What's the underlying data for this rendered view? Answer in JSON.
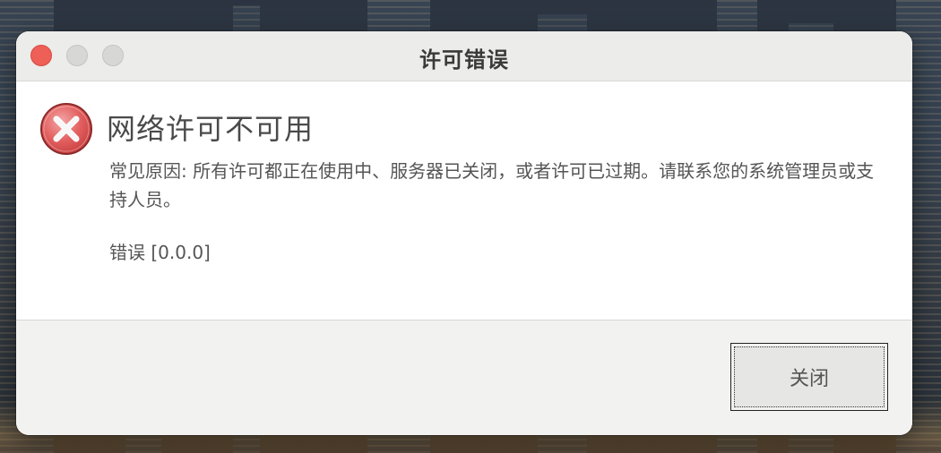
{
  "window": {
    "title": "许可错误"
  },
  "dialog": {
    "icon": "error-x-icon",
    "heading": "网络许可不可用",
    "message": "常见原因: 所有许可都正在使用中、服务器已关闭，或者许可已过期。请联系您的系统管理员或支持人员。",
    "error_code": "错误 [0.0.0]"
  },
  "footer": {
    "close_label": "关闭"
  },
  "colors": {
    "close_light": "#ee5f57",
    "error_icon": "#e36060",
    "window_bg": "#f2f2f0",
    "content_bg": "#ffffff"
  }
}
